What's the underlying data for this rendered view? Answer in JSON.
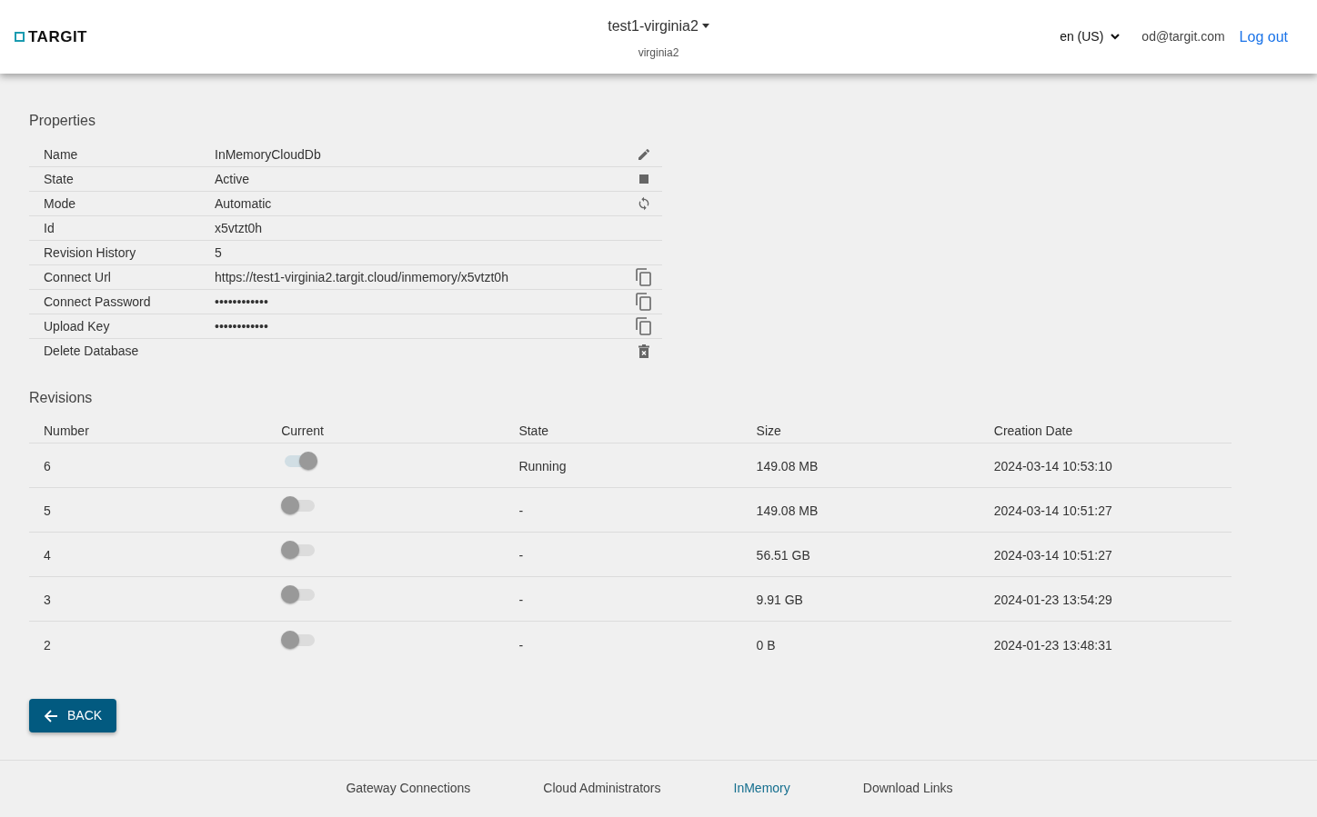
{
  "header": {
    "logo": "TARGIT",
    "tenant": "test1-virginia2",
    "region": "virginia2",
    "language": "en (US)",
    "user": "od@targit.com",
    "logout": "Log out"
  },
  "properties": {
    "title": "Properties",
    "rows": [
      {
        "label": "Name",
        "value": "InMemoryCloudDb",
        "kind": "edit"
      },
      {
        "label": "State",
        "value": "Active",
        "kind": "stop"
      },
      {
        "label": "Mode",
        "value": "Automatic",
        "kind": "sync"
      },
      {
        "label": "Id",
        "value": "x5vtzt0h",
        "kind": "plain"
      },
      {
        "label": "Revision History",
        "value": "5",
        "kind": "plain"
      },
      {
        "label": "Connect Url",
        "value": "https://test1-virginia2.targit.cloud/inmemory/x5vtzt0h",
        "kind": "copy"
      },
      {
        "label": "Connect Password",
        "value": "••••••••••••",
        "kind": "copy"
      },
      {
        "label": "Upload Key",
        "value": "••••••••••••",
        "kind": "copy"
      },
      {
        "label": "Delete Database",
        "kind": "delete"
      }
    ]
  },
  "revisions": {
    "title": "Revisions",
    "columns": [
      "Number",
      "Current",
      "State",
      "Size",
      "Creation Date"
    ],
    "rows": [
      {
        "number": "6",
        "current": true,
        "state": "Running",
        "size": "149.08 MB",
        "created": "2024-03-14 10:53:10"
      },
      {
        "number": "5",
        "current": false,
        "state": "-",
        "size": "149.08 MB",
        "created": "2024-03-14 10:51:27"
      },
      {
        "number": "4",
        "current": false,
        "state": "-",
        "size": "56.51 GB",
        "created": "2024-03-14 10:51:27"
      },
      {
        "number": "3",
        "current": false,
        "state": "-",
        "size": "9.91 GB",
        "created": "2024-01-23 13:54:29"
      },
      {
        "number": "2",
        "current": false,
        "state": "-",
        "size": "0 B",
        "created": "2024-01-23 13:48:31"
      }
    ]
  },
  "back_button": "BACK",
  "footer_links": [
    {
      "label": "Gateway Connections",
      "selected": false
    },
    {
      "label": "Cloud Administrators",
      "selected": false
    },
    {
      "label": "InMemory",
      "selected": true
    },
    {
      "label": "Download Links",
      "selected": false
    }
  ]
}
